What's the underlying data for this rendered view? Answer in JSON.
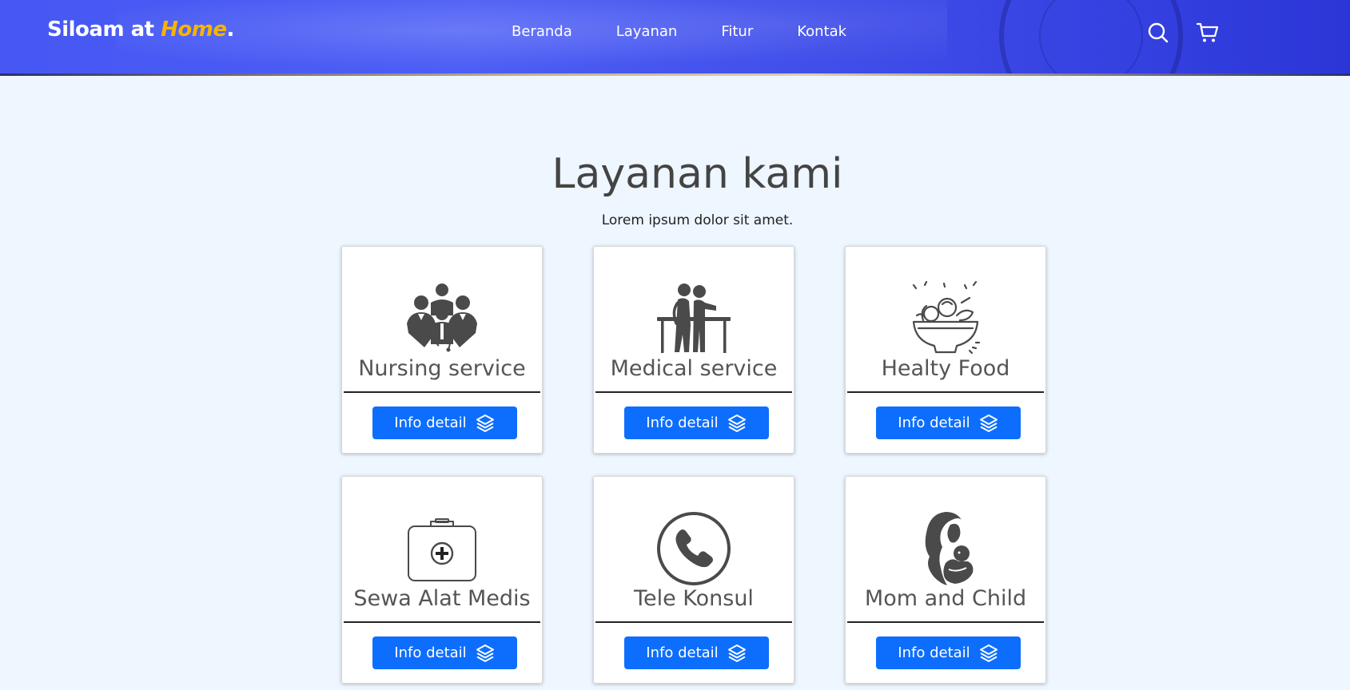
{
  "brand": {
    "prefix": "Siloam at ",
    "accent": "Home",
    "suffix": "."
  },
  "nav": {
    "links": [
      "Beranda",
      "Layanan",
      "Fitur",
      "Kontak"
    ],
    "icons": [
      "search-icon",
      "cart-icon"
    ]
  },
  "section": {
    "title": "Layanan kami",
    "subtitle": "Lorem ipsum dolor sit amet."
  },
  "services": [
    {
      "title": "Nursing service",
      "icon": "medical-team-icon",
      "button": "Info detail"
    },
    {
      "title": "Medical service",
      "icon": "physiotherapy-icon",
      "button": "Info detail"
    },
    {
      "title": "Healty Food",
      "icon": "food-bowl-icon",
      "button": "Info detail"
    },
    {
      "title": "Sewa Alat Medis",
      "icon": "medical-kit-icon",
      "button": "Info detail"
    },
    {
      "title": "Tele Konsul",
      "icon": "phone-icon",
      "button": "Info detail"
    },
    {
      "title": "Mom and Child",
      "icon": "mother-child-icon",
      "button": "Info detail"
    }
  ],
  "colors": {
    "header": "#4657f3",
    "brand_accent": "#f7b500",
    "button": "#0d6efd",
    "page_bg": "#eef6ff",
    "icon": "#4a4a4a"
  }
}
